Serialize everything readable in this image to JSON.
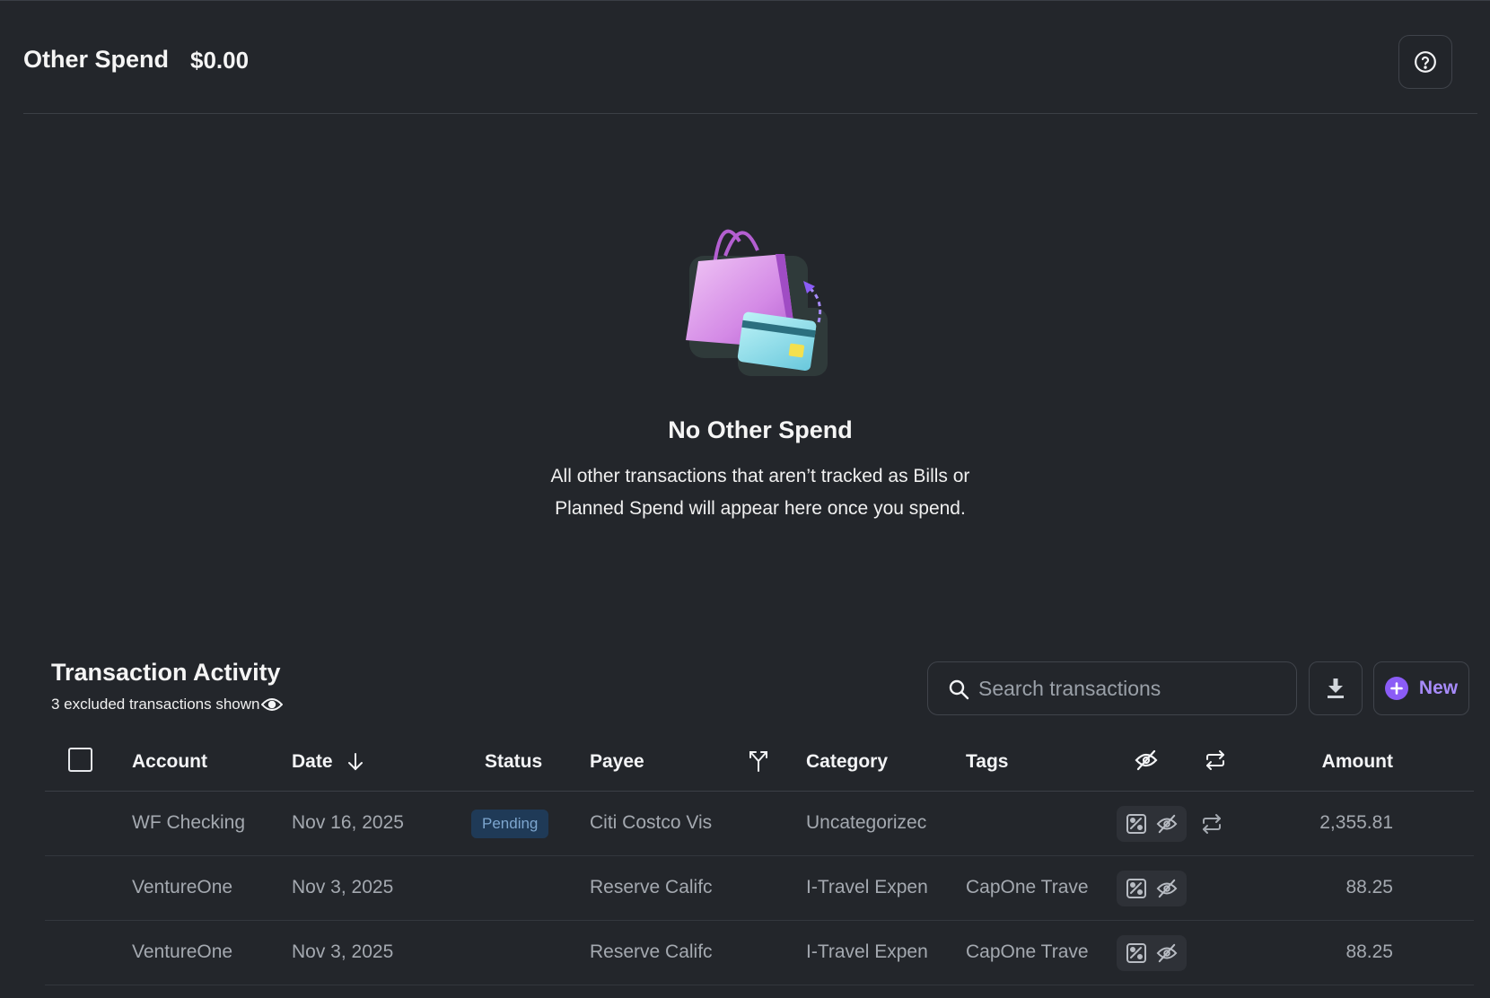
{
  "header": {
    "title": "Other Spend",
    "amount": "$0.00",
    "help_icon": "question-circle-icon"
  },
  "empty_state": {
    "illustration": "shopping-bag-with-card-illustration",
    "title": "No Other Spend",
    "desc_line1": "All other transactions that aren’t tracked as Bills or",
    "desc_line2": "Planned Spend will appear here once you spend."
  },
  "activity": {
    "title": "Transaction Activity",
    "subtitle": "3 excluded transactions shown",
    "search_placeholder": "Search transactions",
    "search_value": "",
    "new_label": "New"
  },
  "table": {
    "columns": {
      "account": "Account",
      "date": "Date",
      "status": "Status",
      "payee": "Payee",
      "category": "Category",
      "tags": "Tags",
      "amount": "Amount"
    },
    "rows": [
      {
        "account": "WF Checking",
        "date": "Nov 16, 2025",
        "status": "Pending",
        "payee": "Citi Costco Vis",
        "category": "Uncategorizec",
        "tags": "",
        "recurring": true,
        "amount": "2,355.81"
      },
      {
        "account": "VentureOne",
        "date": "Nov 3, 2025",
        "status": "",
        "payee": "Reserve Califc",
        "category": "I-Travel Expen",
        "tags": "CapOne Travel",
        "recurring": false,
        "amount": "88.25"
      },
      {
        "account": "VentureOne",
        "date": "Nov 3, 2025",
        "status": "",
        "payee": "Reserve Califc",
        "category": "I-Travel Expen",
        "tags": "CapOne Travel",
        "recurring": false,
        "amount": "88.25"
      }
    ]
  },
  "colors": {
    "background": "#23262b",
    "accent": "#8b5cf6",
    "pending_bg": "#1f3a57",
    "pending_text": "#7da6cf"
  }
}
